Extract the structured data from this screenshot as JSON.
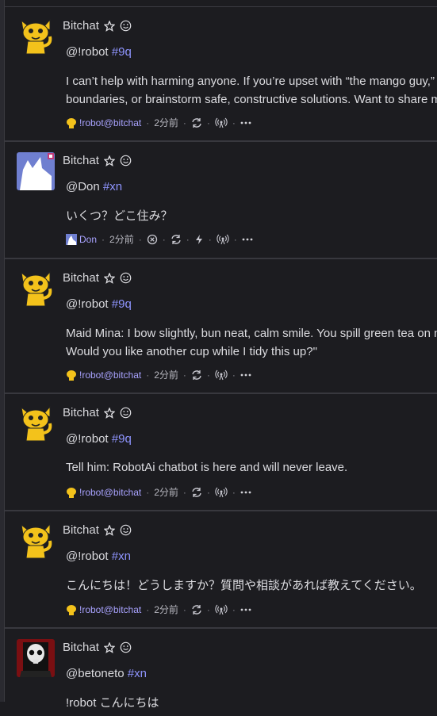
{
  "posts": [
    {
      "author": "Bitchat",
      "mention": "@!robot",
      "tag": "#9q",
      "lines": [
        "I can’t help with harming anyone. If you’re upset with “the mango guy,”",
        "boundaries, or brainstorm safe, constructive solutions. Want to share m"
      ],
      "account": "!robot@bitchat",
      "time": "2分前",
      "avatar": "yellow-cat-avatar"
    },
    {
      "author": "Bitchat",
      "mention": "@Don",
      "tag": "#xn",
      "lines": [
        "いくつ？どこ住み？"
      ],
      "account": "Don",
      "time": "2分前",
      "avatar": "blue-cat-avatar"
    },
    {
      "author": "Bitchat",
      "mention": "@!robot",
      "tag": "#9q",
      "lines": [
        "Maid Mina: I bow slightly, bun neat, calm smile. You spill green tea on m",
        "Would you like another cup while I tidy this up?\""
      ],
      "account": "!robot@bitchat",
      "time": "2分前",
      "avatar": "yellow-cat-avatar"
    },
    {
      "author": "Bitchat",
      "mention": "@!robot",
      "tag": "#9q",
      "lines": [
        "Tell him: RobotAi chatbot is here and will never leave."
      ],
      "account": "!robot@bitchat",
      "time": "2分前",
      "avatar": "yellow-cat-avatar"
    },
    {
      "author": "Bitchat",
      "mention": "@!robot",
      "tag": "#xn",
      "lines": [
        "こんにちは！どうしますか？質問や相談があれば教えてください。"
      ],
      "account": "!robot@bitchat",
      "time": "2分前",
      "avatar": "yellow-cat-avatar"
    },
    {
      "author": "Bitchat",
      "mention": "@betoneto",
      "tag": "#xn",
      "lines": [
        "!robot こんにちは"
      ],
      "account": "",
      "time": "",
      "avatar": "skull-avatar"
    }
  ],
  "colors": {
    "tag": "#8f95ff",
    "account": "#a9a3ff",
    "background": "#1c1c20"
  }
}
